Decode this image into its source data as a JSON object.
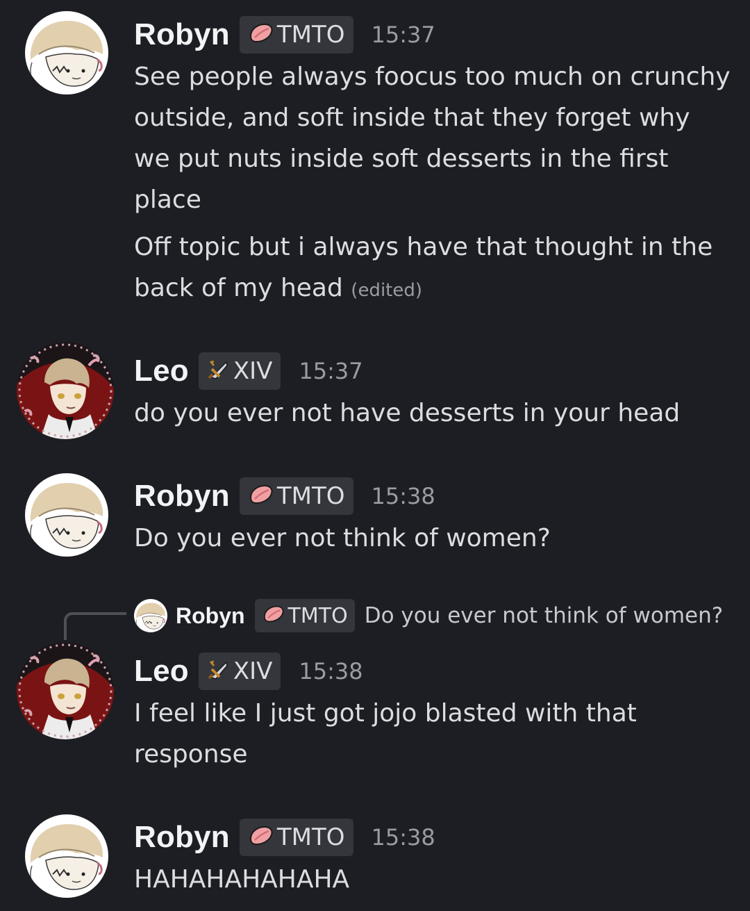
{
  "messages": [
    {
      "author": "Robyn",
      "tag": {
        "label": "TMTO",
        "icon": "peach-slice-icon"
      },
      "time": "15:37",
      "lines": [
        "See people always foocus too much on crunchy",
        "outside, and soft inside that they forget why",
        "we put nuts inside soft desserts in the first",
        "place",
        "Off topic but i always have that thought in the",
        "back of my head"
      ],
      "edited_label": "(edited)"
    },
    {
      "author": "Leo",
      "tag": {
        "label": "XIV",
        "icon": "sword-icon"
      },
      "time": "15:37",
      "lines": [
        "do you ever not have desserts in your head"
      ]
    },
    {
      "author": "Robyn",
      "tag": {
        "label": "TMTO",
        "icon": "peach-slice-icon"
      },
      "time": "15:38",
      "lines": [
        "Do you ever not think of women?"
      ]
    },
    {
      "reply_to": {
        "author": "Robyn",
        "tag": "TMTO",
        "text": "Do you ever not think of women?"
      },
      "author": "Leo",
      "tag": {
        "label": "XIV",
        "icon": "sword-icon"
      },
      "time": "15:38",
      "lines": [
        "I feel like I just got jojo blasted with that",
        "response"
      ]
    },
    {
      "author": "Robyn",
      "tag": {
        "label": "TMTO",
        "icon": "peach-slice-icon"
      },
      "time": "15:38",
      "lines": [
        "HAHAHAHAHAHA"
      ]
    }
  ],
  "colors": {
    "background": "#1d1e23",
    "tag_background": "#34363c",
    "text": "#dbdee1",
    "muted": "#9a9ca5"
  }
}
